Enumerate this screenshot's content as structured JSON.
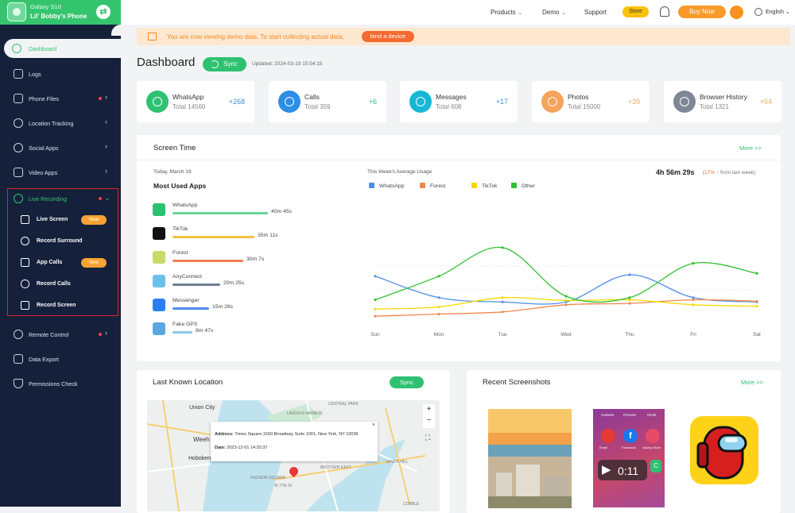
{
  "device": {
    "model": "Galaxy S10",
    "name": "Lil' Bobby's Phone"
  },
  "sidebar": {
    "dashboard": "Dashboard",
    "items": [
      {
        "label": "Logs"
      },
      {
        "label": "Phone Files"
      },
      {
        "label": "Location Tracking"
      },
      {
        "label": "Social Apps"
      },
      {
        "label": "Video Apps"
      }
    ],
    "live_recording": {
      "label": "Live Recording",
      "items": [
        {
          "label": "Live Screen",
          "badge": "New"
        },
        {
          "label": "Record Surround"
        },
        {
          "label": "App Calls",
          "badge": "New"
        },
        {
          "label": "Record Calls"
        },
        {
          "label": "Record Screen"
        }
      ]
    },
    "bottom_items": [
      {
        "label": "Remote Control"
      },
      {
        "label": "Data Export"
      },
      {
        "label": "Permissions Check"
      }
    ]
  },
  "topbar": {
    "products": "Products",
    "demo": "Demo",
    "support": "Support",
    "store": "Store",
    "buy_now": "Buy Now",
    "language": "English"
  },
  "notice": {
    "text": "You are now viewing demo data. To start collecting actual data,",
    "button": "bind a device"
  },
  "header": {
    "title": "Dashboard",
    "sync": "Sync",
    "updated": "Updated: 2024-03-19 15:54:15"
  },
  "cards": [
    {
      "name": "WhatsApp",
      "total": "Total   14560",
      "delta": "+268",
      "color": "#2ec172",
      "delta_color": "#3a8fd8"
    },
    {
      "name": "Calls",
      "total": "Total   359",
      "delta": "+6",
      "color": "#2c8ee6",
      "delta_color": "#2ec172"
    },
    {
      "name": "Messages",
      "total": "Total   608",
      "delta": "+17",
      "color": "#17b7d6",
      "delta_color": "#3a8fd8"
    },
    {
      "name": "Photos",
      "total": "Total   15000",
      "delta": "+39",
      "color": "#f6a35d",
      "delta_color": "#f0a86a"
    },
    {
      "name": "Browser History",
      "total": "Total   1321",
      "delta": "+54",
      "color": "#7f8796",
      "delta_color": "#e9b15b"
    }
  ],
  "screen_time": {
    "title": "Screen Time",
    "more": "More >>",
    "date": "Today, March 19",
    "most_used": "Most Used Apps",
    "apps": [
      {
        "name": "WhatsApp",
        "time": "40m 45s",
        "fraction": 1.0,
        "color": "#67d49a",
        "icon_color": "#2ec172"
      },
      {
        "name": "TikTok",
        "time": "35m 11s",
        "fraction": 0.86,
        "color": "#f5c244",
        "icon_color": "#111111"
      },
      {
        "name": "Forest",
        "time": "30m 7s",
        "fraction": 0.74,
        "color": "#ef7d5a",
        "icon_color": "#c9d96a"
      },
      {
        "name": "AnyConnect",
        "time": "20m 25s",
        "fraction": 0.5,
        "color": "#6c7d92",
        "icon_color": "#6cc0e8"
      },
      {
        "name": "Messenger",
        "time": "15m 26s",
        "fraction": 0.38,
        "color": "#4d8fe6",
        "icon_color": "#2a7ff0"
      },
      {
        "name": "Fake GPS",
        "time": "8m 47s",
        "fraction": 0.21,
        "color": "#88c9ea",
        "icon_color": "#5aa6e0"
      }
    ],
    "weekly_label": "This Week's Average Usage",
    "total": "4h 56m 29s",
    "change_pct": "17%",
    "change_text": "from last week"
  },
  "chart_data": {
    "type": "line",
    "x": [
      "Sun",
      "Mon",
      "Tue",
      "Wed",
      "Thu",
      "Fri",
      "Sat"
    ],
    "series": [
      {
        "name": "WhatsApp",
        "color": "#4e8fe6",
        "values": [
          68,
          38,
          32,
          32,
          70,
          38,
          32
        ]
      },
      {
        "name": "Forest",
        "color": "#f0884e",
        "values": [
          12,
          15,
          18,
          28,
          30,
          35,
          33
        ]
      },
      {
        "name": "TikTok",
        "color": "#f5d800",
        "values": [
          22,
          25,
          38,
          34,
          35,
          28,
          26
        ]
      },
      {
        "name": "Other",
        "color": "#2ec131",
        "values": [
          35,
          68,
          108,
          40,
          38,
          86,
          72
        ]
      }
    ],
    "grid": false,
    "legend": "top-left"
  },
  "location": {
    "title": "Last Known Location",
    "sync": "Sync",
    "address_label": "Address:",
    "address": "Times Square,1560 Broadway Suite 1001, New York, NY 10036",
    "date_label": "Date:",
    "date": "2023-12-01 14:20:37",
    "map_labels": [
      "Union City",
      "Weeh",
      "Hoboken"
    ],
    "map_small": [
      "LINCOLN HARBOR",
      "CENTRAL PARK",
      "MIDTOWN EAST",
      "HUDSON SQUARE",
      "W 27th St",
      "LENOX HILL",
      "COBBLE"
    ]
  },
  "screenshots": {
    "title": "Recent Screenshots",
    "more": "More >>",
    "phone_labels": [
      "Camera",
      "Chrome",
      "Clock",
      "Email",
      "Facebook",
      "Galaxy Store"
    ],
    "video_time": "0:11"
  }
}
